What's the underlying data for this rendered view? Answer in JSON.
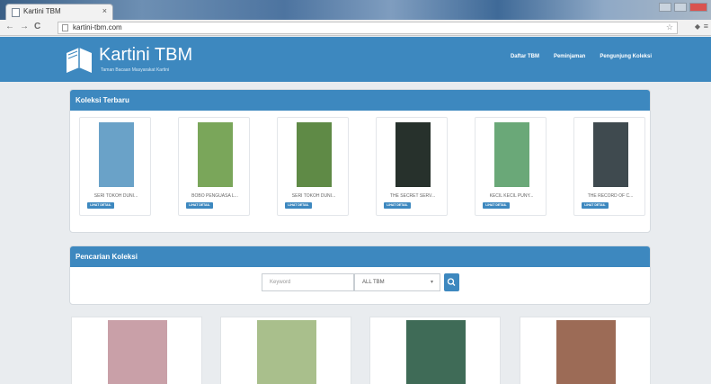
{
  "browser": {
    "tab_title": "Kartini TBM",
    "tab_close": "×",
    "back": "←",
    "forward": "→",
    "reload": "C",
    "url": "kartini-tbm.com",
    "star": "☆",
    "menu": "≡"
  },
  "site": {
    "brand": "Kartini TBM",
    "tagline": "Taman Bacaan Masyarakat Kartini",
    "nav": [
      "Daftar TBM",
      "Peminjaman",
      "Pengunjung Koleksi"
    ]
  },
  "latest": {
    "heading": "Koleksi Terbaru",
    "detail_label": "LIHAT DETAIL",
    "books": [
      {
        "title": "SERI TOKOH DUNI...",
        "cover_color": "#6aa2c8"
      },
      {
        "title": "BOBO PENGUASA L...",
        "cover_color": "#7aa65a"
      },
      {
        "title": "SERI TOKOH DUNI...",
        "cover_color": "#5f8a46"
      },
      {
        "title": "THE SECRET SERV...",
        "cover_color": "#27312c"
      },
      {
        "title": "KECIL KECIL PUNY...",
        "cover_color": "#6aa878"
      },
      {
        "title": "THE RECORD OF C...",
        "cover_color": "#3f4a4f"
      }
    ]
  },
  "search": {
    "heading": "Pencarian Koleksi",
    "keyword_placeholder": "Keyword",
    "tbm_selected": "ALL TBM",
    "caret": "▾"
  },
  "more_books": [
    {
      "cover_color": "#c9a0a8"
    },
    {
      "cover_color": "#a9bf8c"
    },
    {
      "cover_color": "#3f6b57"
    },
    {
      "cover_color": "#9c6b56"
    }
  ]
}
